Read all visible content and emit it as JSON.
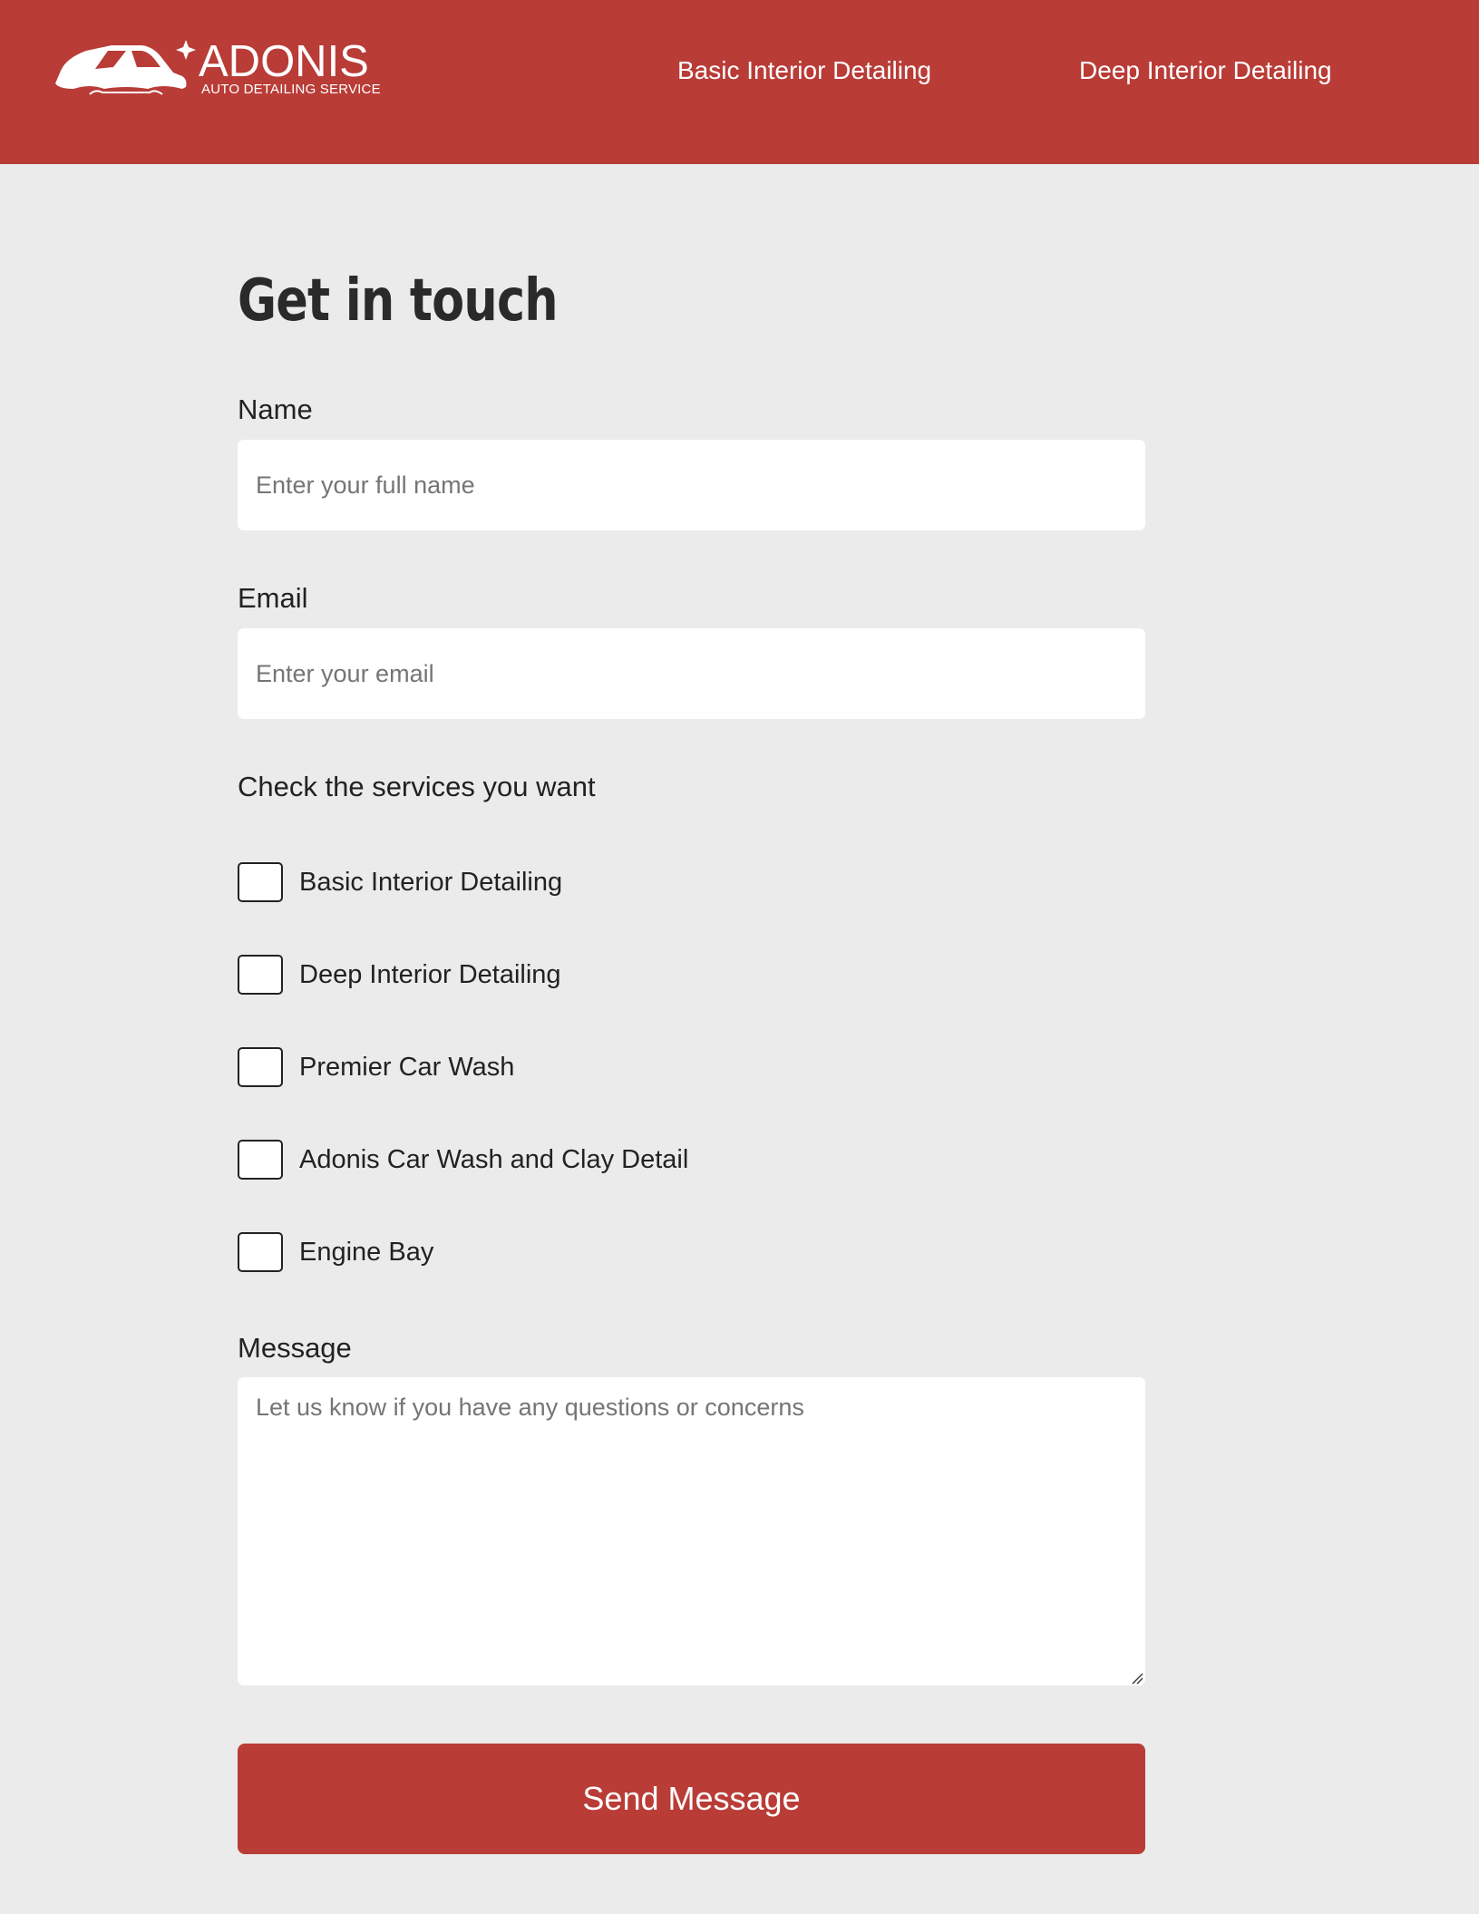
{
  "colors": {
    "brand": "#b93c37",
    "page_background": "#ebebeb",
    "text": "#222222",
    "placeholder": "#757575"
  },
  "header": {
    "logo": {
      "icon": "car-logo-icon",
      "title": "ADONIS",
      "subtitle": "AUTO DETAILING SERVICE"
    },
    "nav": [
      {
        "label": "Basic Interior Detailing"
      },
      {
        "label": "Deep Interior Detailing"
      }
    ]
  },
  "form": {
    "title": "Get in touch",
    "name": {
      "label": "Name",
      "placeholder": "Enter your full name",
      "value": ""
    },
    "email": {
      "label": "Email",
      "placeholder": "Enter your email",
      "value": ""
    },
    "services": {
      "label": "Check the services you want",
      "options": [
        {
          "label": "Basic Interior Detailing",
          "checked": false
        },
        {
          "label": "Deep Interior Detailing",
          "checked": false
        },
        {
          "label": "Premier Car Wash",
          "checked": false
        },
        {
          "label": "Adonis Car Wash and Clay Detail",
          "checked": false
        },
        {
          "label": "Engine Bay",
          "checked": false
        }
      ]
    },
    "message": {
      "label": "Message",
      "placeholder": "Let us know if you have any questions or concerns",
      "value": ""
    },
    "submit_label": "Send Message"
  }
}
